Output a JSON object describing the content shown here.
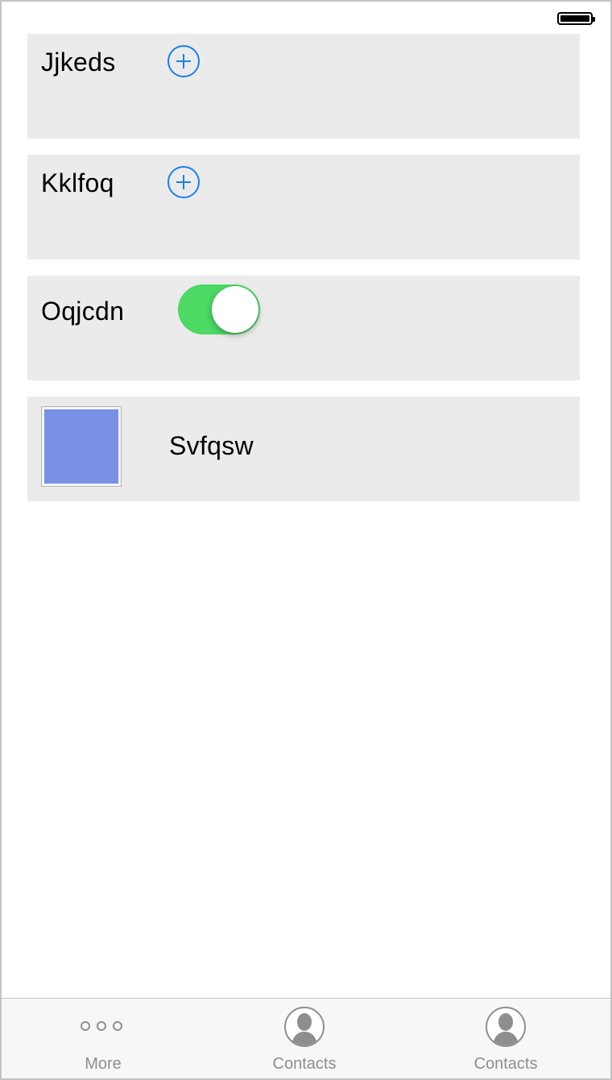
{
  "cells": [
    {
      "label": "Jjkeds",
      "control": "add-button"
    },
    {
      "label": "Kklfoq",
      "control": "add-button"
    },
    {
      "label": "Oqjcdn",
      "control": "toggle",
      "toggle_on": true
    },
    {
      "label": "Svfqsw",
      "control": "image-swatch",
      "swatch_color": "#7891e6"
    }
  ],
  "tabbar": {
    "tabs": [
      {
        "label": "More",
        "icon": "more-dots-icon"
      },
      {
        "label": "Contacts",
        "icon": "contact-person-icon"
      },
      {
        "label": "Contacts",
        "icon": "contact-person-icon"
      }
    ]
  },
  "colors": {
    "accent": "#1b7ff0",
    "toggle_on": "#4cd964",
    "cell_background": "#ebebeb",
    "tab_inactive": "#8e8e8e"
  }
}
